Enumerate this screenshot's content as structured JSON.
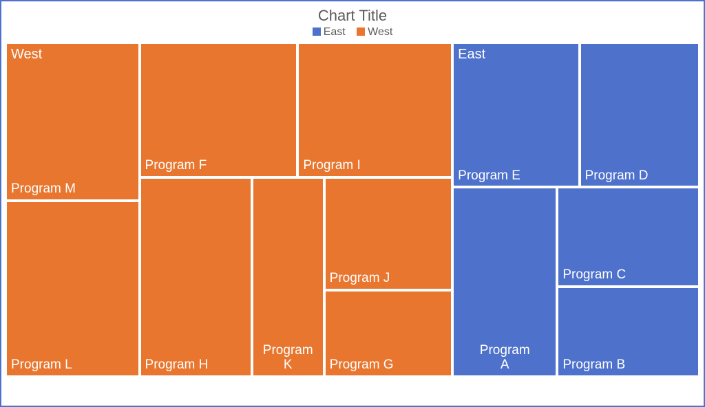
{
  "title": "Chart Title",
  "legend": {
    "east": "East",
    "west": "West"
  },
  "region_labels": {
    "west": "West",
    "east": "East"
  },
  "cells": {
    "m": "Program M",
    "l": "Program L",
    "f": "Program F",
    "i": "Program I",
    "h": "Program H",
    "k": "Program K",
    "j": "Program J",
    "g": "Program G",
    "e": "Program E",
    "d": "Program D",
    "a": "Program A",
    "c": "Program C",
    "b": "Program B"
  },
  "chart_data": {
    "type": "treemap",
    "title": "Chart Title",
    "series": [
      {
        "name": "West",
        "color": "#e8762f",
        "items": [
          {
            "label": "Program M",
            "value": 43000
          },
          {
            "label": "Program L",
            "value": 47000
          },
          {
            "label": "Program F",
            "value": 43000
          },
          {
            "label": "Program I",
            "value": 42000
          },
          {
            "label": "Program H",
            "value": 45000
          },
          {
            "label": "Program K",
            "value": 29000
          },
          {
            "label": "Program J",
            "value": 26000
          },
          {
            "label": "Program G",
            "value": 20000
          }
        ]
      },
      {
        "name": "East",
        "color": "#4e71cc",
        "items": [
          {
            "label": "Program E",
            "value": 37000
          },
          {
            "label": "Program D",
            "value": 35000
          },
          {
            "label": "Program A",
            "value": 40000
          },
          {
            "label": "Program C",
            "value": 30000
          },
          {
            "label": "Program B",
            "value": 27000
          }
        ]
      }
    ]
  }
}
